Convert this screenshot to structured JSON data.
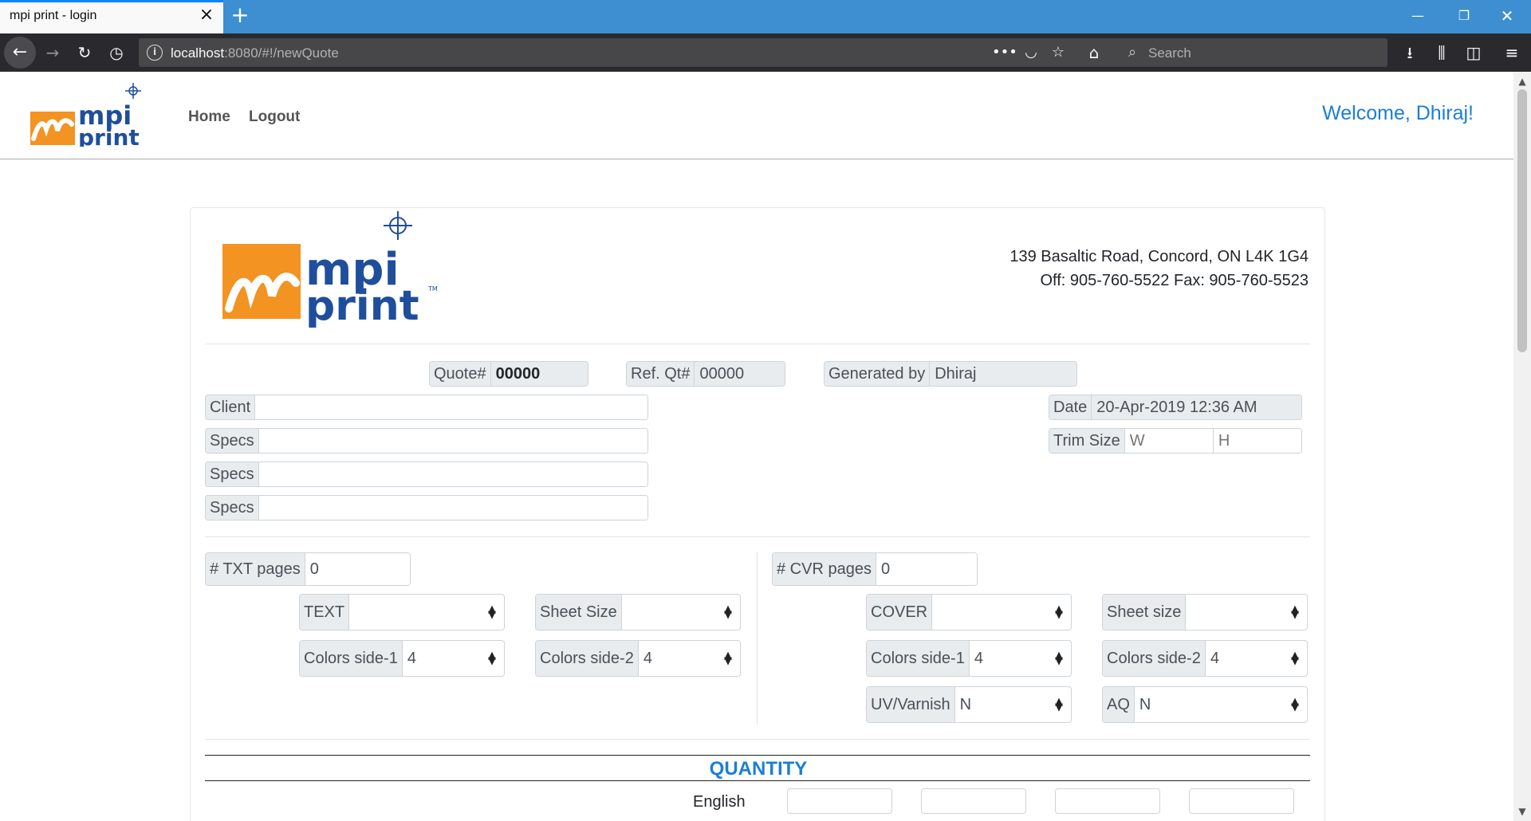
{
  "browser": {
    "tab_title": "mpi print - login",
    "url_host": "localhost",
    "url_rest": ":8080/#!/newQuote",
    "search_placeholder": "Search"
  },
  "header": {
    "logo_text_top": "mpi",
    "logo_text_bottom": "print",
    "nav": {
      "home": "Home",
      "logout": "Logout"
    },
    "welcome": "Welcome, Dhiraj!"
  },
  "company": {
    "logo_text_top": "mpi",
    "logo_text_bottom": "print",
    "tm": "TM",
    "address": "139 Basaltic Road, Concord, ON L4K 1G4",
    "phones": "Off: 905-760-5522 Fax: 905-760-5523"
  },
  "quote": {
    "quote_no_label": "Quote#",
    "quote_no": "00000",
    "ref_label": "Ref. Qt#",
    "ref_no": "00000",
    "generated_by_label": "Generated by",
    "generated_by": "Dhiraj",
    "client_label": "Client",
    "client": "",
    "specs_label": "Specs",
    "specs": [
      "",
      "",
      ""
    ],
    "date_label": "Date",
    "date": "20-Apr-2019 12:36 AM",
    "trim_label": "Trim Size",
    "trim_w_placeholder": "W",
    "trim_h_placeholder": "H"
  },
  "text_section": {
    "pages_label": "# TXT pages",
    "pages": "0",
    "stock_label": "TEXT",
    "stock": "",
    "sheet_label": "Sheet Size",
    "sheet": "",
    "colors1_label": "Colors side-1",
    "colors1": "4",
    "colors2_label": "Colors side-2",
    "colors2": "4"
  },
  "cover_section": {
    "pages_label": "# CVR pages",
    "pages": "0",
    "stock_label": "COVER",
    "stock": "",
    "sheet_label": "Sheet size",
    "sheet": "",
    "colors1_label": "Colors side-1",
    "colors1": "4",
    "colors2_label": "Colors side-2",
    "colors2": "4",
    "uv_label": "UV/Varnish",
    "uv": "N",
    "aq_label": "AQ",
    "aq": "N"
  },
  "quantity": {
    "title": "QUANTITY",
    "language": "English",
    "values": [
      "",
      "",
      "",
      ""
    ]
  },
  "colors": {
    "brand_orange": "#f39322",
    "brand_blue": "#1f4e9c",
    "link_blue": "#1c7ed6",
    "browser_blue": "#3d8fd1",
    "toolbar_dark": "#2a2a2e"
  }
}
